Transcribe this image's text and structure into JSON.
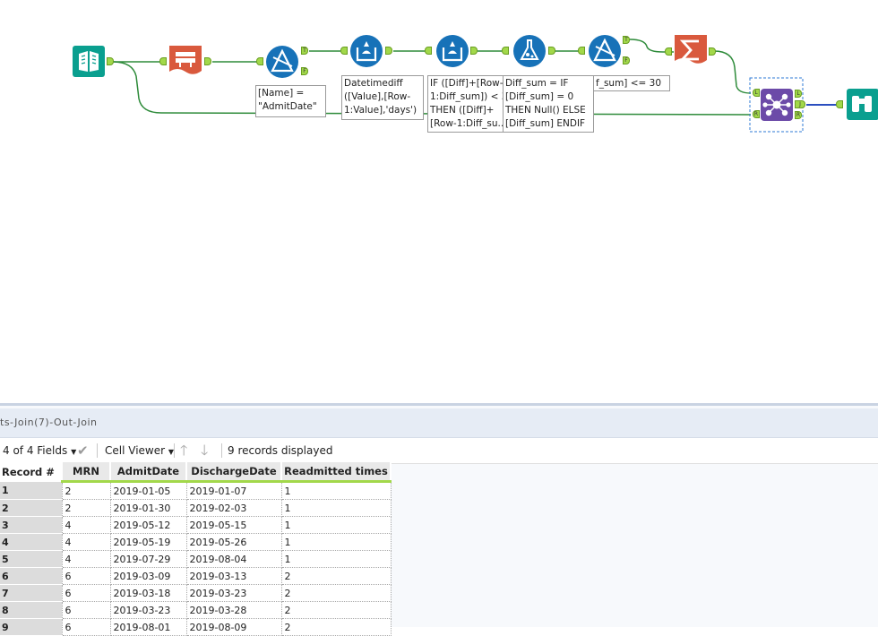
{
  "canvas": {
    "annotations": {
      "filter1": "[Name] =\n\"AdmitDate\"",
      "formula1": "Datetimediff\n([Value],[Row-\n1:Value],'days')",
      "multirow1": "IF ([Diff]+[Row-\n1:Diff_sum]) < 3\nTHEN ([Diff]+\n[Row-1:Diff_su...",
      "multirow2": "Diff_sum = IF\n[Diff_sum] = 0\nTHEN Null() ELSE\n[Diff_sum] ENDIF",
      "filter2": "f_sum] <= 30"
    },
    "anchor_labels": {
      "true": "T",
      "false": "F",
      "left": "L",
      "right": "R",
      "join": "J"
    },
    "colors": {
      "wire": "#2e8b3a",
      "input_teal": "#0a9f8f",
      "crosstab_red": "#d9593d",
      "blue_tool": "#1772b8",
      "summarize_red": "#d9593d",
      "join_purple": "#6c4aa8",
      "browse_teal": "#0a9f8f",
      "anchor_green": "#a2d84a"
    },
    "icons": [
      "input-book-icon",
      "crosstab-icon",
      "filter-icon",
      "multirow-formula-icon",
      "formula-icon",
      "summarize-sigma-icon",
      "join-icon",
      "browse-binoculars-icon"
    ]
  },
  "results": {
    "title": "ts-Join(7)-Out-Join",
    "fields_label": "4 of 4 Fields",
    "viewer_label": "Cell Viewer",
    "records_label": "9 records displayed",
    "columns": [
      "Record #",
      "MRN",
      "AdmitDate",
      "DischargeDate",
      "Readmitted times"
    ],
    "rows": [
      [
        "1",
        "2",
        "2019-01-05",
        "2019-01-07",
        "1"
      ],
      [
        "2",
        "2",
        "2019-01-30",
        "2019-02-03",
        "1"
      ],
      [
        "3",
        "4",
        "2019-05-12",
        "2019-05-15",
        "1"
      ],
      [
        "4",
        "4",
        "2019-05-19",
        "2019-05-26",
        "1"
      ],
      [
        "5",
        "4",
        "2019-07-29",
        "2019-08-04",
        "1"
      ],
      [
        "6",
        "6",
        "2019-03-09",
        "2019-03-13",
        "2"
      ],
      [
        "7",
        "6",
        "2019-03-18",
        "2019-03-23",
        "2"
      ],
      [
        "8",
        "6",
        "2019-03-23",
        "2019-03-28",
        "2"
      ],
      [
        "9",
        "6",
        "2019-08-01",
        "2019-08-09",
        "2"
      ]
    ]
  }
}
